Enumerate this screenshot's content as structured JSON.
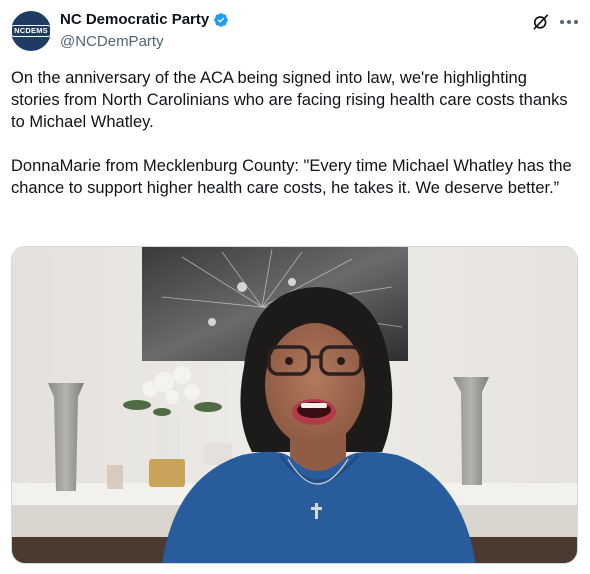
{
  "account": {
    "avatar_text": "NCDEMS",
    "display_name": "NC Democratic Party",
    "handle": "@NCDemParty",
    "verified": true
  },
  "icons": {
    "verified": "verified-badge-icon",
    "grok": "grok-icon",
    "more": "more-options-icon"
  },
  "colors": {
    "avatar_bg": "#1f3a63",
    "verified_blue": "#1d9bf0",
    "secondary_text": "#536471"
  },
  "tweet": {
    "text": "On the anniversary of the ACA being signed into law, we're highlighting stories from North Carolinians who are facing rising health care costs thanks to Michael Whatley.\n\nDonnaMarie from Mecklenburg County: \"Every time Michael Whatley has the chance to support higher health care costs, he takes it. We deserve better.”"
  }
}
